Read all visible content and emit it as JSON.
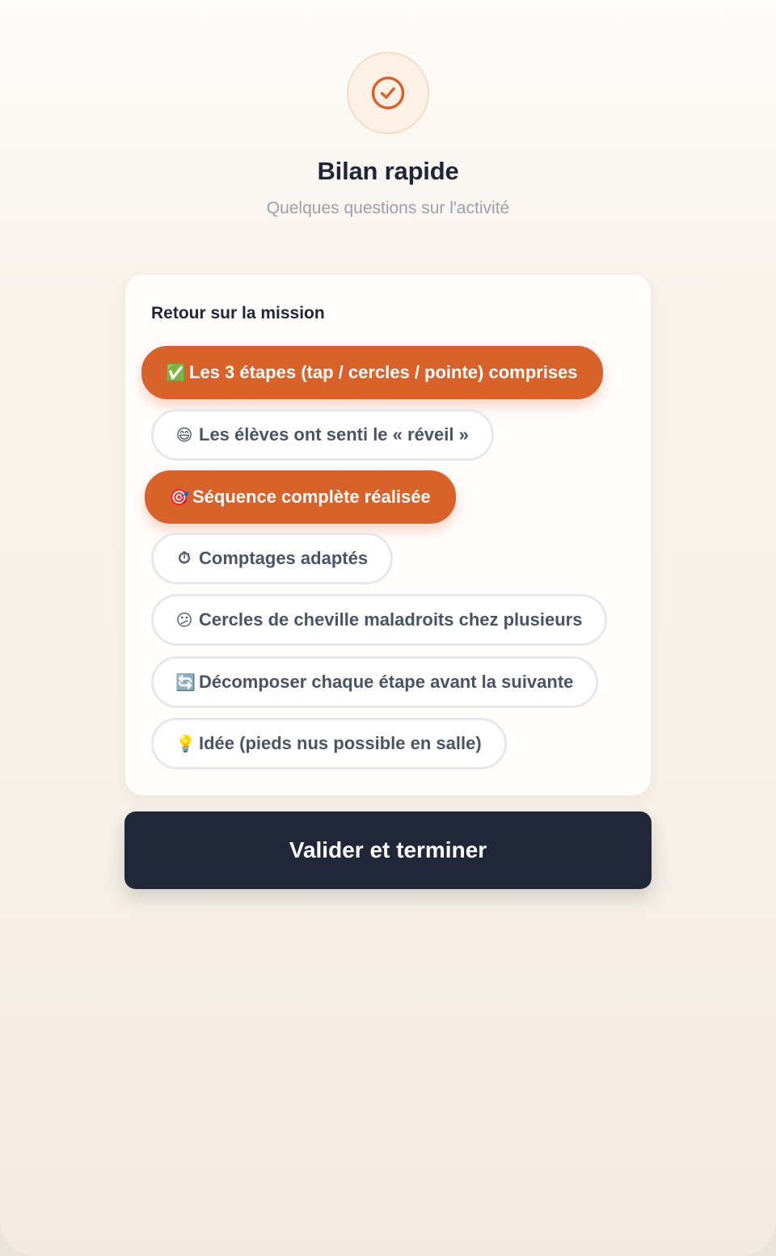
{
  "header": {
    "icon": "check-circle-icon",
    "accent_color": "#d9622b",
    "title": "Bilan rapide",
    "subtitle": "Quelques questions sur l'activité"
  },
  "card": {
    "title": "Retour sur la mission",
    "chips": [
      {
        "emoji": "✅",
        "label": "Les 3 étapes (tap / cercles / pointe) comprises",
        "selected": true
      },
      {
        "emoji": "😄",
        "label": "Les élèves ont senti le « réveil »",
        "selected": false
      },
      {
        "emoji": "🎯",
        "label": "Séquence complète réalisée",
        "selected": true
      },
      {
        "emoji": "⏱",
        "label": "Comptages adaptés",
        "selected": false
      },
      {
        "emoji": "😕",
        "label": "Cercles de cheville maladroits chez plusieurs",
        "selected": false
      },
      {
        "emoji": "🔄",
        "label": "Décomposer chaque étape avant la suivante",
        "selected": false
      },
      {
        "emoji": "💡",
        "label": "Idée (pieds nus possible en salle)",
        "selected": false
      }
    ]
  },
  "submit_label": "Valider et terminer"
}
